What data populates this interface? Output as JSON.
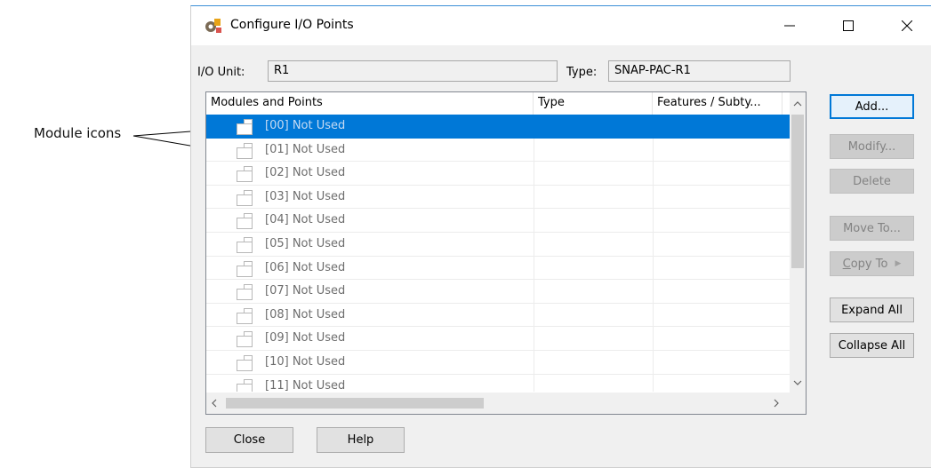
{
  "callout": {
    "label": "Module icons"
  },
  "window": {
    "title": "Configure I/O Points",
    "controls": {
      "minimize": "—",
      "maximize": "☐",
      "close": "✕"
    }
  },
  "io_unit": {
    "label": "I/O Unit:",
    "value": "R1"
  },
  "type_field": {
    "label": "Type:",
    "value": "SNAP-PAC-R1"
  },
  "list": {
    "columns": [
      "Modules and Points",
      "Type",
      "Features / Subty..."
    ],
    "rows": [
      "[00] Not Used",
      "[01] Not Used",
      "[02] Not Used",
      "[03] Not Used",
      "[04] Not Used",
      "[05] Not Used",
      "[06] Not Used",
      "[07] Not Used",
      "[08] Not Used",
      "[09] Not Used",
      "[10] Not Used",
      "[11] Not Used"
    ],
    "selected_index": 0
  },
  "buttons": {
    "add": "Add...",
    "modify": "Modify...",
    "delete": "Delete",
    "move_to": "Move To...",
    "copy_to_first": "C",
    "copy_to_rest": "opy To",
    "expand_all": "Expand All",
    "collapse_all": "Collapse All",
    "close": "Close",
    "help": "Help"
  },
  "colors": {
    "selection": "#0078d7",
    "accent_border": "#3b8fd6"
  }
}
